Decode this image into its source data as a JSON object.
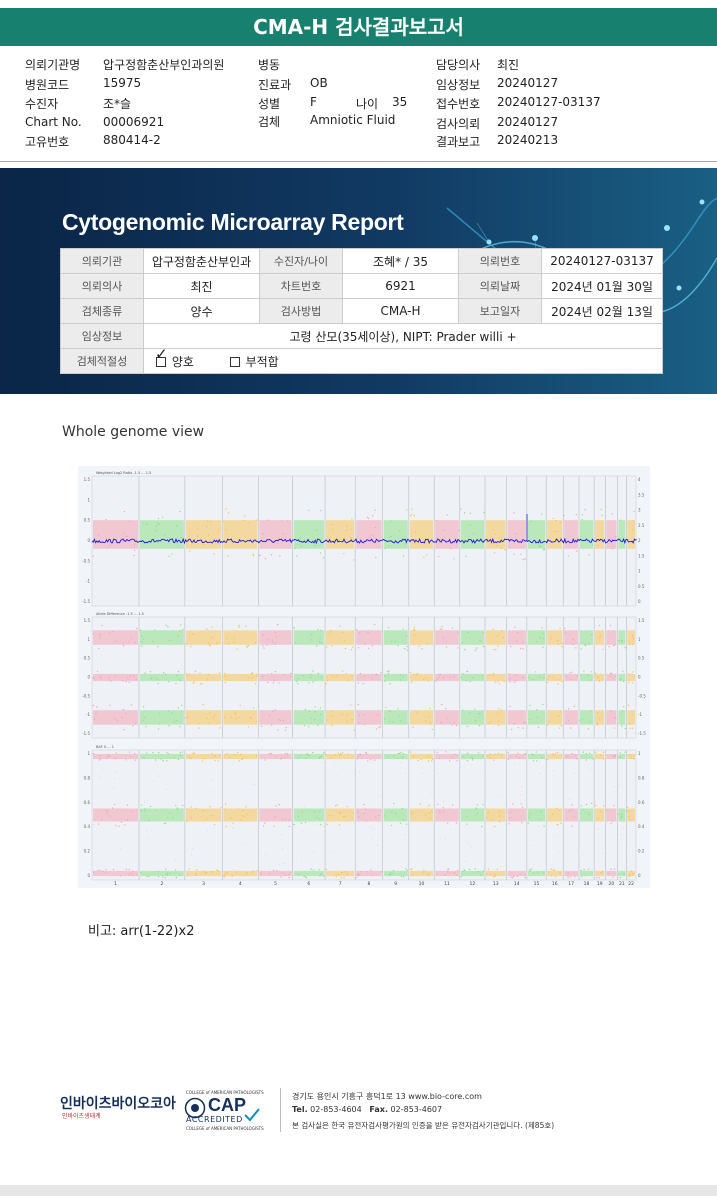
{
  "header": {
    "title": "CMA-H 검사결과보고서"
  },
  "info": {
    "col1": [
      {
        "label": "의뢰기관명",
        "value": "압구정함춘산부인과의원"
      },
      {
        "label": "병원코드",
        "value": "15975"
      },
      {
        "label": "수진자",
        "value": "조*슬"
      },
      {
        "label": "Chart No.",
        "value": "00006921"
      },
      {
        "label": "고유번호",
        "value": "880414-2"
      }
    ],
    "col2": [
      {
        "label": "병동",
        "value": ""
      },
      {
        "label": "진료과",
        "value": "OB"
      },
      {
        "label": "성별",
        "value": "F"
      },
      {
        "label": "검체",
        "value": "Amniotic Fluid"
      }
    ],
    "age": {
      "label": "나이",
      "value": "35"
    },
    "col3": [
      {
        "label": "담당의사",
        "value": "최진"
      },
      {
        "label": "임상정보",
        "value": "20240127"
      },
      {
        "label": "접수번호",
        "value": "20240127-03137"
      },
      {
        "label": "검사의뢰",
        "value": "20240127"
      },
      {
        "label": "결과보고",
        "value": "20240213"
      }
    ]
  },
  "report": {
    "title": "Cytogenomic Microarray Report",
    "table": {
      "r1": [
        "의뢰기관",
        "압구정함춘산부인과",
        "수진자/나이",
        "조혜* / 35",
        "의뢰번호",
        "20240127-03137"
      ],
      "r2": [
        "의뢰의사",
        "최진",
        "차트번호",
        "6921",
        "의뢰날짜",
        "2024년 01월 30일"
      ],
      "r3": [
        "검체종류",
        "양수",
        "검사방법",
        "CMA-H",
        "보고일자",
        "2024년 02월 13일"
      ],
      "r4": [
        "임상정보",
        "고령 산모(35세이상), NIPT: Prader willi +"
      ],
      "r5": [
        "검체적절성",
        "양호",
        "부적합"
      ]
    }
  },
  "genome_view": {
    "title": "Whole genome view",
    "panels": [
      {
        "label": "Weighted Log2 Ratio -1.5 ... 1.5",
        "left_ticks": [
          "1.5",
          "1",
          "0.5",
          "0",
          "-0.5",
          "-1",
          "-1.5"
        ],
        "right_ticks": [
          "4",
          "3.5",
          "3",
          "2.5",
          "2",
          "1.5",
          "1",
          "0.5",
          "0"
        ]
      },
      {
        "label": "Allele Difference -1.5 ... 1.5",
        "left_ticks": [
          "1.5",
          "1",
          "0.5",
          "0",
          "-0.5",
          "-1",
          "-1.5"
        ],
        "right_ticks": [
          "1.5",
          "1",
          "0.5",
          "0",
          "-0.5",
          "-1",
          "-1.5"
        ]
      },
      {
        "label": "BAF 0 ... 1",
        "left_ticks": [
          "1",
          "0.8",
          "0.6",
          "0.4",
          "0.2",
          "0"
        ],
        "right_ticks": [
          "1",
          "0.8",
          "0.6",
          "0.4",
          "0.2",
          "0"
        ]
      }
    ],
    "chromosomes": [
      "1",
      "2",
      "3",
      "4",
      "5",
      "6",
      "7",
      "8",
      "9",
      "10",
      "11",
      "12",
      "13",
      "14",
      "15",
      "16",
      "17",
      "18",
      "19",
      "20",
      "21",
      "22"
    ]
  },
  "remark": "비고: arr(1-22)x2",
  "footer": {
    "company": "인바이츠바이오코아",
    "company_sub": "인바이츠생태계",
    "cap_top": "COLLEGE of AMERICAN PATHOLOGISTS",
    "cap": "CAP",
    "cap_acc": "ACCREDITED",
    "cap_bottom": "COLLEGE of AMERICAN PATHOLOGISTS",
    "address": "경기도 용인시 기흥구 흥덕1로 13   www.bio-core.com",
    "tel_label": "Tel.",
    "tel": "02-853-4604",
    "fax_label": "Fax.",
    "fax": "02-853-4607",
    "cert": "본 검사실은 한국 유전자검사평가원의 인증을 받은 유전자검사기관입니다. (제85호)"
  }
}
